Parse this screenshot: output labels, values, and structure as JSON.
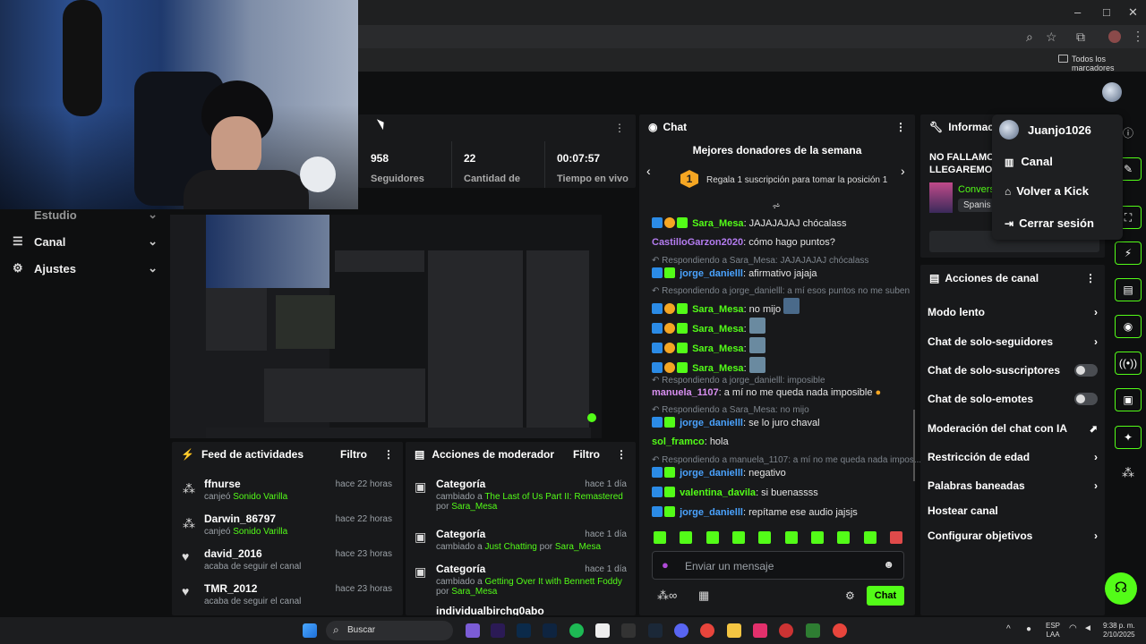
{
  "browser": {
    "bookmarks_label": "Todos los marcadores"
  },
  "sidebar": {
    "items": [
      {
        "label": "Estudio"
      },
      {
        "label": "Canal"
      },
      {
        "label": "Ajustes"
      }
    ]
  },
  "stats": {
    "followers_value": "958",
    "followers_label": "Seguidores",
    "amount_value": "22",
    "amount_label": "Cantidad de",
    "time_value": "00:07:57",
    "time_label": "Tiempo en vivo"
  },
  "chat": {
    "title": "Chat",
    "donors_title": "Mejores donadores de la semana",
    "donors_rank": "1",
    "donors_text": "Regala 1 suscripción para tomar la posición 1",
    "messages": [
      {
        "user": "Sara_Mesa",
        "text": ": JAJAJAJAJ chócalass"
      },
      {
        "user": "CastilloGarzon2020",
        "text": ": cómo hago puntos?"
      },
      {
        "reply": "Respondiendo a Sara_Mesa: JAJAJAJAJ chócalass"
      },
      {
        "user": "jorge_danielll",
        "text": ": afirmativo jajaja"
      },
      {
        "reply": "Respondiendo a jorge_danielll: a mí esos puntos no me suben"
      },
      {
        "user": "Sara_Mesa",
        "text": ": no mijo"
      },
      {
        "user": "Sara_Mesa",
        "text": ":"
      },
      {
        "user": "Sara_Mesa",
        "text": ":"
      },
      {
        "user": "Sara_Mesa",
        "text": ":"
      },
      {
        "reply": "Respondiendo a jorge_danielll: imposible"
      },
      {
        "user": "manuela_1107",
        "text": ": a mí no me queda nada imposible"
      },
      {
        "reply": "Respondiendo a Sara_Mesa: no mijo"
      },
      {
        "user": "jorge_danielll",
        "text": ": se lo juro chaval"
      },
      {
        "user": "sol_framco",
        "text": ": hola"
      },
      {
        "reply": "Respondiendo a manuela_1107: a mí no me queda nada impos..."
      },
      {
        "user": "jorge_danielll",
        "text": ": negativo"
      },
      {
        "user": "valentina_davila",
        "text": ": si buenassss"
      },
      {
        "user": "jorge_danielll",
        "text": ": repítame ese audio jajsjs"
      }
    ],
    "input_placeholder": "Enviar un mensaje",
    "send_label": "Chat"
  },
  "info": {
    "title": "Informació",
    "stream_title_line1": "NO FALLAMO",
    "stream_title_line2": "LLEGAREMOS",
    "category": "Convers",
    "language": "Spanis"
  },
  "channel_actions": {
    "title": "Acciones de canal",
    "items": [
      {
        "label": "Modo lento"
      },
      {
        "label": "Chat de solo-seguidores"
      },
      {
        "label": "Chat de solo-suscriptores"
      },
      {
        "label": "Chat de solo-emotes"
      },
      {
        "label": "Moderación del chat con IA"
      },
      {
        "label": "Restricción de edad"
      },
      {
        "label": "Palabras baneadas"
      },
      {
        "label": "Hostear canal"
      },
      {
        "label": "Configurar objetivos"
      }
    ]
  },
  "feed": {
    "title": "Feed de actividades",
    "filter": "Filtro",
    "items": [
      {
        "name": "ffnurse",
        "action": "canjeó",
        "reward": "Sonido Varilla",
        "time": "hace 22 horas"
      },
      {
        "name": "Darwin_86797",
        "action": "canjeó",
        "reward": "Sonido Varilla",
        "time": "hace 22 horas"
      },
      {
        "name": "david_2016",
        "action": "acaba de seguir el canal",
        "reward": "",
        "time": "hace 23 horas"
      },
      {
        "name": "TMR_2012",
        "action": "acaba de seguir el canal",
        "reward": "",
        "time": "hace 23 horas"
      }
    ]
  },
  "mod_actions": {
    "title": "Acciones de moderador",
    "filter": "Filtro",
    "items": [
      {
        "title": "Categoría",
        "time": "hace 1 día",
        "prefix": "cambiado a",
        "target": "The Last of Us Part II: Remastered",
        "by": "por",
        "user": "Sara_Mesa"
      },
      {
        "title": "Categoría",
        "time": "hace 1 día",
        "prefix": "cambiado a",
        "target": "Just Chatting",
        "by": "por",
        "user": "Sara_Mesa"
      },
      {
        "title": "Categoría",
        "time": "hace 1 día",
        "prefix": "cambiado a",
        "target": "Getting Over It with Bennett Foddy",
        "by": "por",
        "user": "Sara_Mesa"
      }
    ],
    "partial_row": "individualbirchg0abo"
  },
  "menu": {
    "username": "Juanjo1026",
    "items": [
      {
        "label": "Canal"
      },
      {
        "label": "Volver a Kick"
      },
      {
        "label": "Cerrar sesión"
      }
    ]
  },
  "taskbar": {
    "search_label": "Buscar",
    "lang_line1": "ESP",
    "lang_line2": "LAA",
    "time": "9:38 p. m.",
    "date": "2/10/2025"
  },
  "colors": {
    "accent": "#53fc18",
    "panel": "#18191b",
    "background": "#0e0f10"
  }
}
